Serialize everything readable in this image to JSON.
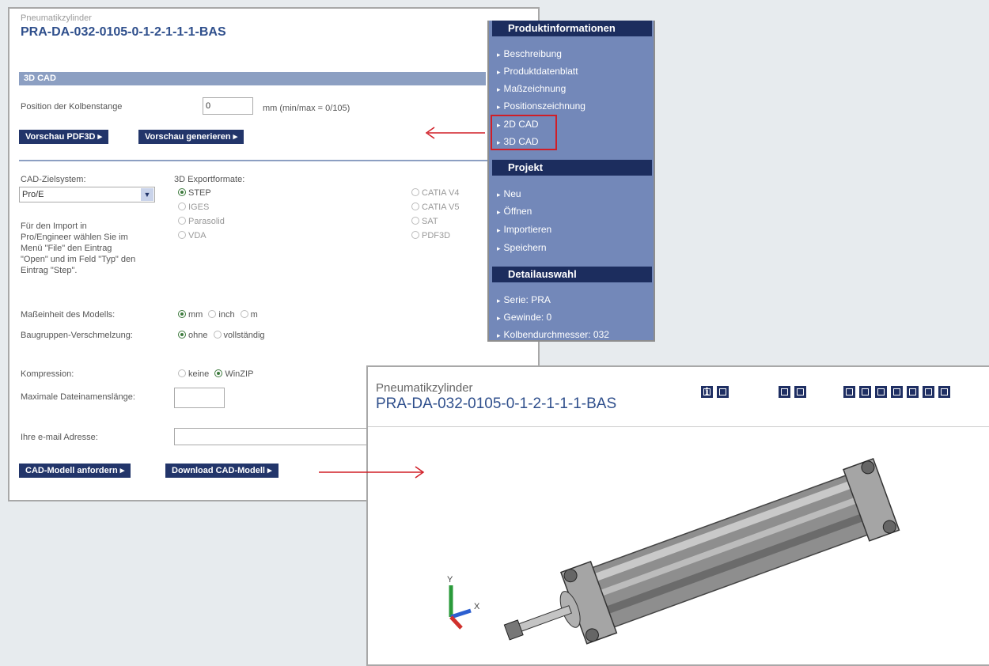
{
  "form": {
    "category": "Pneumatikzylinder",
    "part_number": "PRA-DA-032-0105-0-1-2-1-1-1-BAS",
    "section_title": "3D CAD",
    "rod_position_label": "Position der Kolbenstange",
    "rod_position_value": "0",
    "rod_position_unit": "mm  (min/max = 0/105)",
    "btn_preview_pdf3d": "Vorschau PDF3D ▸",
    "btn_generate_preview": "Vorschau generieren ▸",
    "cad_target_label": "CAD-Zielsystem:",
    "cad_target_value": "Pro/E",
    "import_hint": [
      "Für den Import in",
      "Pro/Engineer wählen Sie im",
      "Menü \"File\" den Eintrag",
      "\"Open\" und im Feld \"Typ\" den",
      "Eintrag \"Step\"."
    ],
    "export_label": "3D Exportformate:",
    "formats_left": [
      {
        "label": "STEP",
        "selected": true
      },
      {
        "label": "IGES",
        "selected": false
      },
      {
        "label": "Parasolid",
        "selected": false
      },
      {
        "label": "VDA",
        "selected": false
      }
    ],
    "formats_right": [
      {
        "label": "CATIA V4",
        "selected": false
      },
      {
        "label": "CATIA V5",
        "selected": false
      },
      {
        "label": "SAT",
        "selected": false
      },
      {
        "label": "PDF3D",
        "selected": false
      }
    ],
    "unit_label": "Maßeinheit des Modells:",
    "unit_options": [
      "mm",
      "inch",
      "m"
    ],
    "merge_label": "Baugruppen-Verschmelzung:",
    "merge_options": [
      "ohne",
      "vollständig"
    ],
    "compression_label": "Kompression:",
    "compression_options": [
      "keine",
      "WinZIP"
    ],
    "filename_len_label": "Maximale Dateinamenslänge:",
    "filename_len_value": "",
    "email_label": "Ihre e-mail Adresse:",
    "email_value": "",
    "btn_request": "CAD-Modell anfordern ▸",
    "btn_download": "Download CAD-Modell ▸"
  },
  "nav": {
    "product_header": "Produktinformationen",
    "product_items": [
      "Beschreibung",
      "Produktdatenblatt",
      "Maßzeichnung",
      "Positionszeichnung",
      "2D CAD",
      "3D CAD"
    ],
    "project_header": "Projekt",
    "project_items": [
      "Neu",
      "Öffnen",
      "Importieren",
      "Speichern"
    ],
    "detail_header": "Detailauswahl",
    "detail_items": [
      "Serie: PRA",
      "Gewinde: 0",
      "Kolbendurchmesser: 032"
    ]
  },
  "viewer": {
    "category": "Pneumatikzylinder",
    "part_number": "PRA-DA-032-0105-0-1-2-1-1-1-BAS",
    "info_icon_text": "i",
    "axis_labels": [
      "Y",
      "X"
    ]
  },
  "colors": {
    "nav_bg": "#7388b9",
    "nav_header": "#1c2d5e",
    "button": "#22356a",
    "title_blue": "#2f4f8c",
    "highlight": "#d01e27"
  }
}
